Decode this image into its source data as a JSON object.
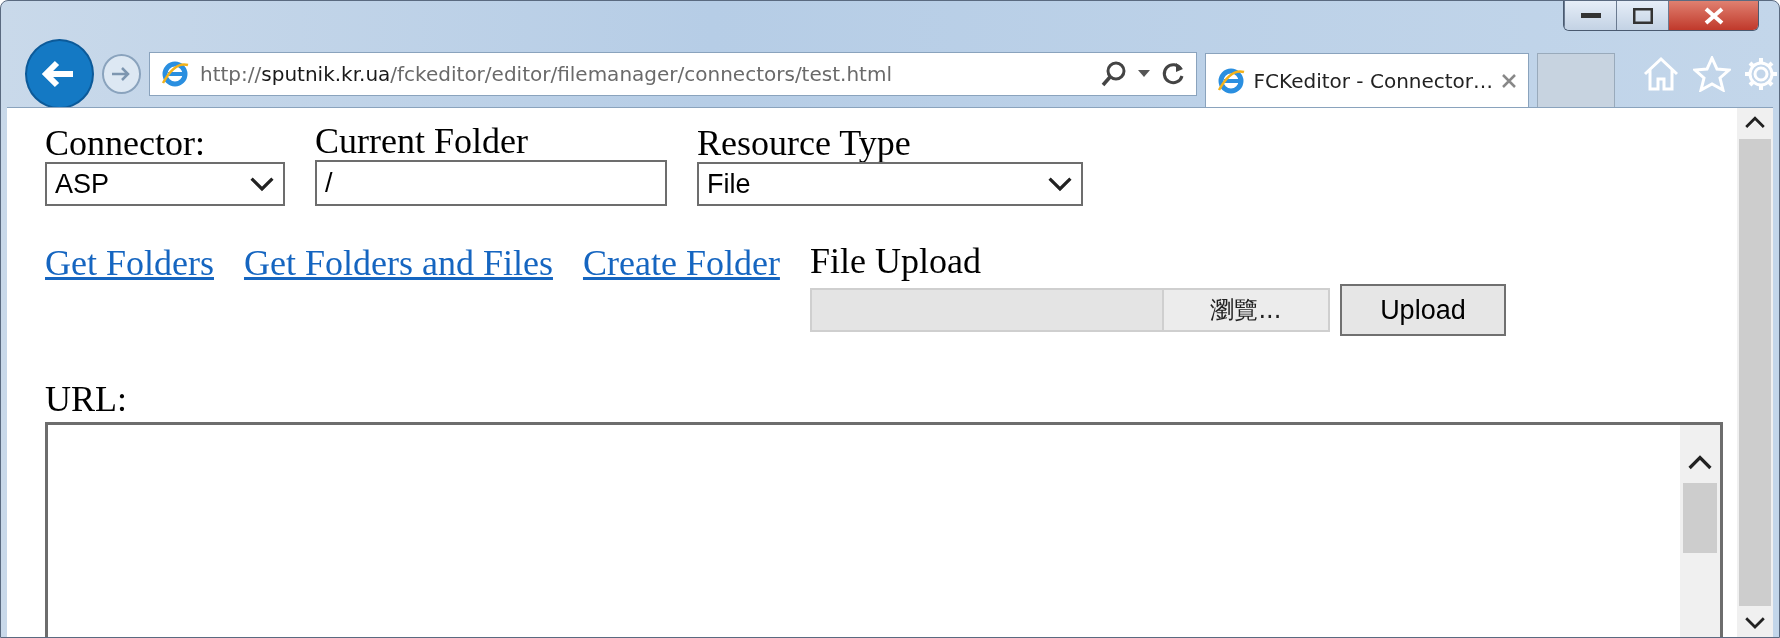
{
  "browser": {
    "address": {
      "prefix": "http://",
      "domain": "sputnik.kr.ua",
      "path": "/fckeditor/editor/filemanager/connectors/test.html"
    },
    "tab": {
      "title": "FCKeditor - Connector…"
    }
  },
  "form": {
    "connector": {
      "label": "Connector:",
      "value": "ASP"
    },
    "current_folder": {
      "label": "Current Folder",
      "value": "/"
    },
    "resource_type": {
      "label": "Resource Type",
      "value": "File"
    },
    "links": [
      "Get Folders",
      "Get Folders and Files",
      "Create Folder"
    ],
    "upload": {
      "label": "File Upload",
      "browse": "瀏覽...",
      "button": "Upload"
    },
    "url": {
      "label": "URL:"
    }
  }
}
